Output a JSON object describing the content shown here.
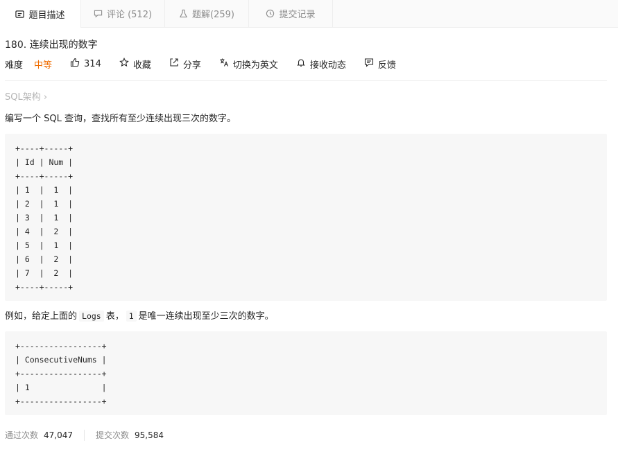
{
  "tabs": [
    {
      "label": "题目描述",
      "icon": "description-icon"
    },
    {
      "label": "评论 (512)",
      "icon": "comment-icon"
    },
    {
      "label": "题解(259)",
      "icon": "flask-icon"
    },
    {
      "label": "提交记录",
      "icon": "clock-icon"
    }
  ],
  "problem": {
    "title": "180. 连续出现的数字",
    "difficulty_label": "难度",
    "difficulty": "中等",
    "difficulty_color": "#ef6c00",
    "likes": "314",
    "actions": {
      "favorite": "收藏",
      "share": "分享",
      "switch_lang": "切换为英文",
      "notify": "接收动态",
      "feedback": "反馈"
    },
    "breadcrumb": "SQL架构 ›",
    "description": "编写一个 SQL 查询，查找所有至少连续出现三次的数字。",
    "table1": "+----+-----+\n| Id | Num |\n+----+-----+\n| 1  |  1  |\n| 2  |  1  |\n| 3  |  1  |\n| 4  |  2  |\n| 5  |  1  |\n| 6  |  2  |\n| 7  |  2  |\n+----+-----+",
    "example_prefix": "例如，给定上面的",
    "example_table_name": "Logs",
    "example_mid": "表，",
    "example_value": "1",
    "example_suffix": "是唯一连续出现至少三次的数字。",
    "table2": "+-----------------+\n| ConsecutiveNums |\n+-----------------+\n| 1               |\n+-----------------+"
  },
  "stats": {
    "accepted_label": "通过次数",
    "accepted_value": "47,047",
    "submitted_label": "提交次数",
    "submitted_value": "95,584"
  }
}
